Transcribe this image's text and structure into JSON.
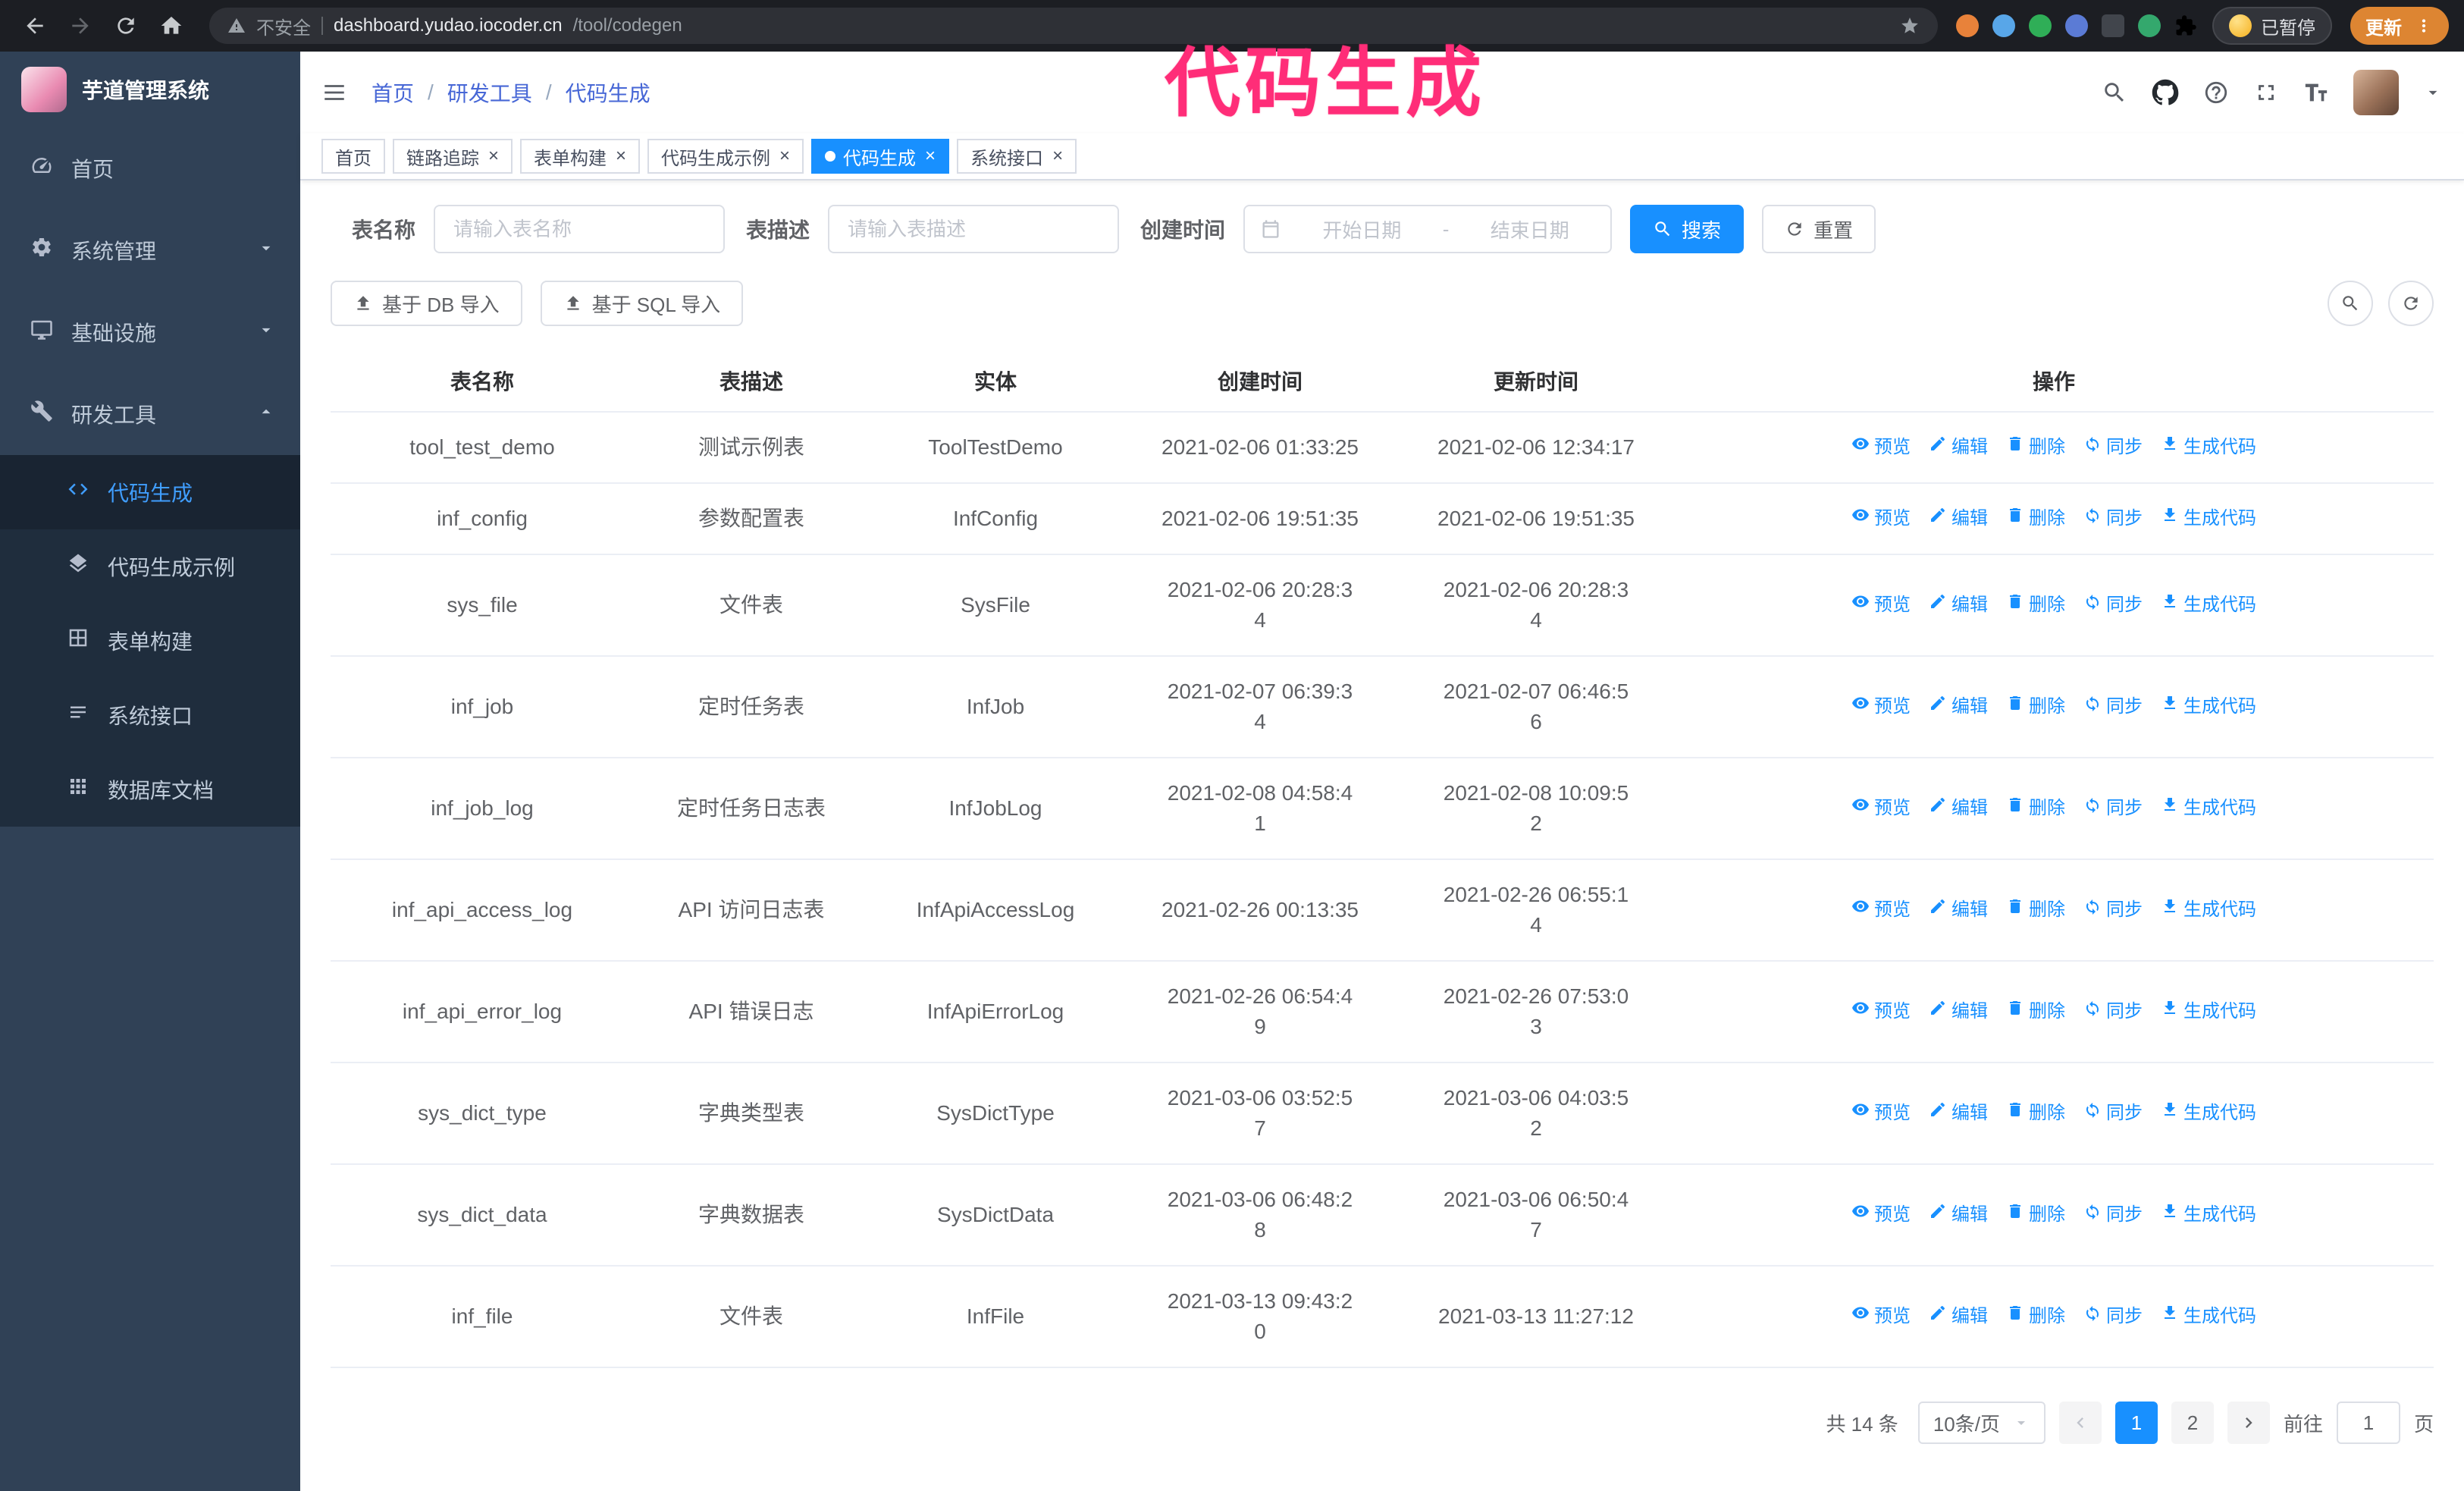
{
  "colors": {
    "accent": "#1890ff",
    "sidebar_bg": "#304156",
    "submenu_bg": "#1f2d3d",
    "active_menu": "#409eff",
    "annotation": "#ff2d78",
    "update_button": "#dd8532"
  },
  "browser": {
    "security_label": "不安全",
    "url_domain": "dashboard.yudao.iocoder.cn",
    "url_path": "/tool/codegen",
    "profile_badge": "已暂停",
    "update_button": "更新",
    "extensions": [
      {
        "name": "extension-orange",
        "color": "#e8823a",
        "shape": "circle"
      },
      {
        "name": "extension-blue-drop",
        "color": "#58a6e8",
        "shape": "circle"
      },
      {
        "name": "extension-green-check",
        "color": "#2fae57",
        "shape": "circle"
      },
      {
        "name": "extension-people",
        "color": "#5b7bd5",
        "shape": "circle"
      },
      {
        "name": "extension-dark-card",
        "color": "#41454c",
        "shape": "square"
      },
      {
        "name": "extension-leaf",
        "color": "#34a86d",
        "shape": "circle"
      },
      {
        "name": "extension-puzzle",
        "color": "#b8bcc2",
        "shape": "puzzle"
      }
    ]
  },
  "annotation": {
    "text": "代码生成"
  },
  "sidebar": {
    "logo_title": "芋道管理系统",
    "items": [
      {
        "label": "首页",
        "icon": "dash",
        "chevron": ""
      },
      {
        "label": "系统管理",
        "icon": "gear",
        "chevron": "down"
      },
      {
        "label": "基础设施",
        "icon": "monitor",
        "chevron": "down"
      },
      {
        "label": "研发工具",
        "icon": "tools",
        "chevron": "up"
      }
    ],
    "subitems": [
      {
        "label": "代码生成",
        "icon": "code",
        "active": true
      },
      {
        "label": "代码生成示例",
        "icon": "layers",
        "active": false
      },
      {
        "label": "表单构建",
        "icon": "form",
        "active": false
      },
      {
        "label": "系统接口",
        "icon": "api",
        "active": false
      },
      {
        "label": "数据库文档",
        "icon": "grid",
        "active": false
      }
    ]
  },
  "header": {
    "breadcrumb": [
      "首页",
      "研发工具",
      "代码生成"
    ]
  },
  "tabs": [
    {
      "label": "首页",
      "closable": false,
      "active": false
    },
    {
      "label": "链路追踪",
      "closable": true,
      "active": false
    },
    {
      "label": "表单构建",
      "closable": true,
      "active": false
    },
    {
      "label": "代码生成示例",
      "closable": true,
      "active": false
    },
    {
      "label": "代码生成",
      "closable": true,
      "active": true
    },
    {
      "label": "系统接口",
      "closable": true,
      "active": false
    }
  ],
  "filters": {
    "table_name_label": "表名称",
    "table_name_placeholder": "请输入表名称",
    "table_desc_label": "表描述",
    "table_desc_placeholder": "请输入表描述",
    "create_time_label": "创建时间",
    "date_start_placeholder": "开始日期",
    "date_separator": "-",
    "date_end_placeholder": "结束日期",
    "search_button": "搜索",
    "reset_button": "重置"
  },
  "toolbar": {
    "import_db_button": "基于 DB 导入",
    "import_sql_button": "基于 SQL 导入"
  },
  "table": {
    "columns": [
      "表名称",
      "表描述",
      "实体",
      "创建时间",
      "更新时间",
      "操作"
    ],
    "action_labels": [
      "预览",
      "编辑",
      "删除",
      "同步",
      "生成代码"
    ],
    "rows": [
      {
        "name": "tool_test_demo",
        "desc": "测试示例表",
        "entity": "ToolTestDemo",
        "created": "2021-02-06 01:33:25",
        "updated": "2021-02-06 12:34:17"
      },
      {
        "name": "inf_config",
        "desc": "参数配置表",
        "entity": "InfConfig",
        "created": "2021-02-06 19:51:35",
        "updated": "2021-02-06 19:51:35"
      },
      {
        "name": "sys_file",
        "desc": "文件表",
        "entity": "SysFile",
        "created": "2021-02-06 20:28:34",
        "updated": "2021-02-06 20:28:34"
      },
      {
        "name": "inf_job",
        "desc": "定时任务表",
        "entity": "InfJob",
        "created": "2021-02-07 06:39:34",
        "updated": "2021-02-07 06:46:56"
      },
      {
        "name": "inf_job_log",
        "desc": "定时任务日志表",
        "entity": "InfJobLog",
        "created": "2021-02-08 04:58:41",
        "updated": "2021-02-08 10:09:52"
      },
      {
        "name": "inf_api_access_log",
        "desc": "API 访问日志表",
        "entity": "InfApiAccessLog",
        "created": "2021-02-26 00:13:35",
        "updated": "2021-02-26 06:55:14"
      },
      {
        "name": "inf_api_error_log",
        "desc": "API 错误日志",
        "entity": "InfApiErrorLog",
        "created": "2021-02-26 06:54:49",
        "updated": "2021-02-26 07:53:03"
      },
      {
        "name": "sys_dict_type",
        "desc": "字典类型表",
        "entity": "SysDictType",
        "created": "2021-03-06 03:52:57",
        "updated": "2021-03-06 04:03:52"
      },
      {
        "name": "sys_dict_data",
        "desc": "字典数据表",
        "entity": "SysDictData",
        "created": "2021-03-06 06:48:28",
        "updated": "2021-03-06 06:50:47"
      },
      {
        "name": "inf_file",
        "desc": "文件表",
        "entity": "InfFile",
        "created": "2021-03-13 09:43:20",
        "updated": "2021-03-13 11:27:12"
      }
    ]
  },
  "pagination": {
    "total": "共 14 条",
    "page_size": "10条/页",
    "pages": [
      "1",
      "2"
    ],
    "active_page": "1",
    "goto_label": "前往",
    "goto_value": "1",
    "goto_unit": "页"
  }
}
